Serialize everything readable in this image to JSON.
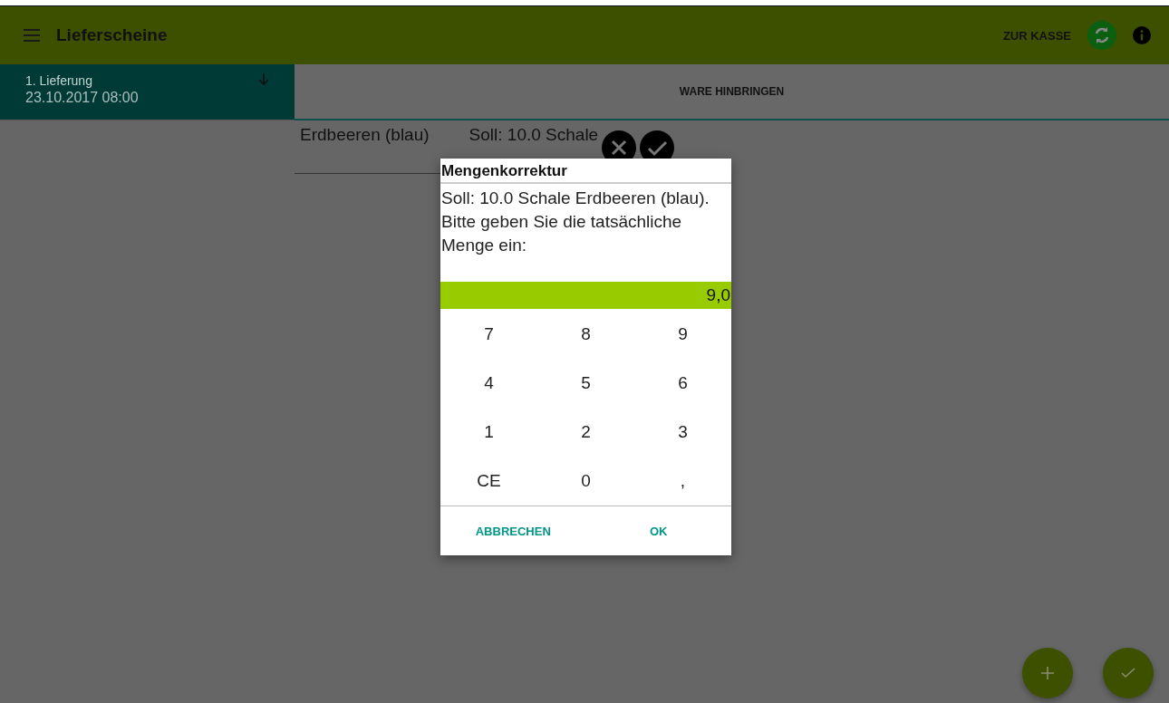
{
  "app_bar": {
    "title": "Lieferscheine",
    "action": "ZUR KASSE"
  },
  "deliveries": [
    {
      "title": "1. Lieferung",
      "date": "23.10.2017 08:00",
      "selected": true
    }
  ],
  "tabs": [
    {
      "label": "WARE HINBRINGEN",
      "selected": true
    }
  ],
  "items": [
    {
      "name": "Erdbeeren (blau)",
      "target": "Soll: 10.0 Schale"
    }
  ],
  "dialog": {
    "title": "Mengenkorrektur",
    "message": "Soll: 10.0 Schale Erdbeeren (blau). Bitte geben Sie die tatsächliche Menge ein:",
    "value": "9,0",
    "keys": [
      "7",
      "8",
      "9",
      "4",
      "5",
      "6",
      "1",
      "2",
      "3",
      "CE",
      "0",
      ","
    ],
    "buttons": [
      "ABBRECHEN",
      "OK"
    ]
  }
}
